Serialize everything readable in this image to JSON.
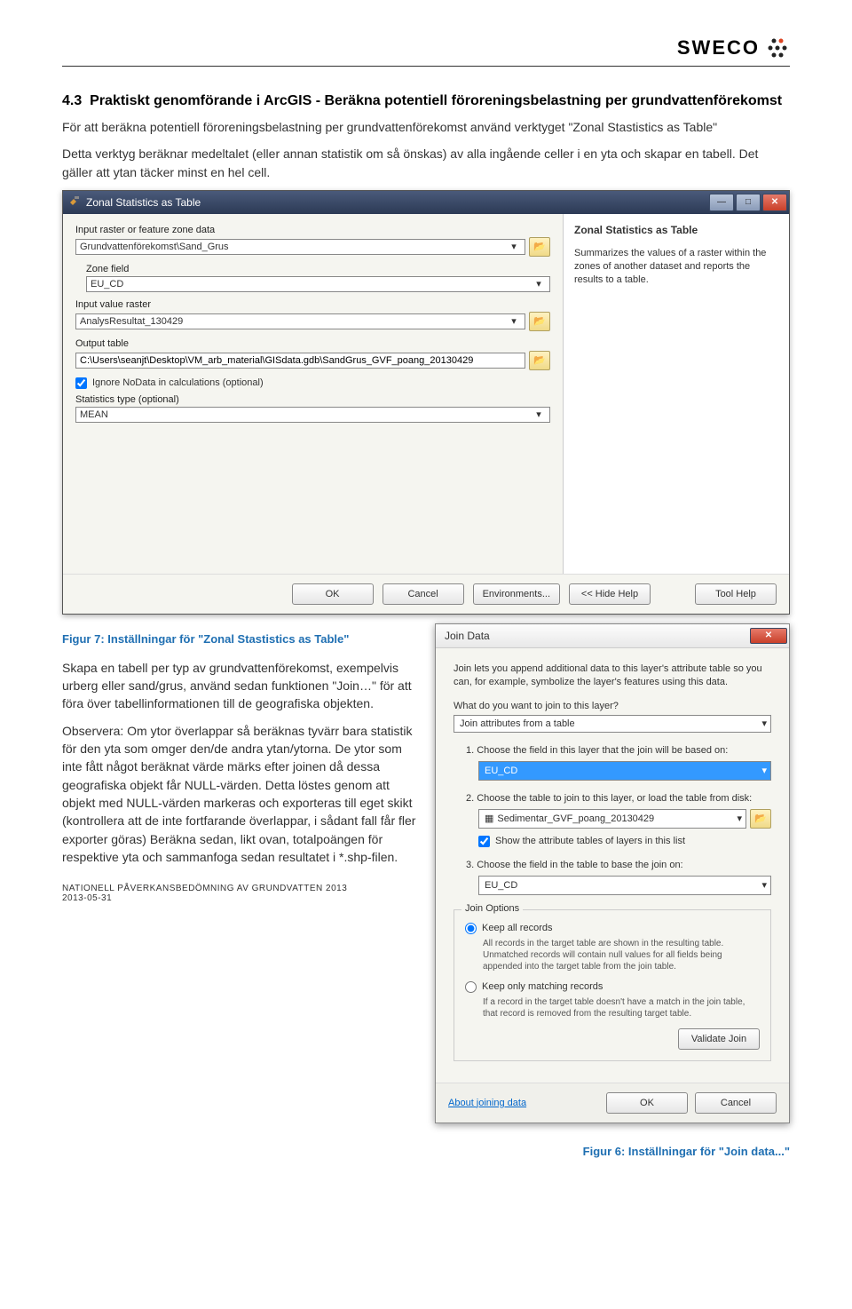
{
  "header": {
    "logo_text": "SWECO"
  },
  "section": {
    "number": "4.3",
    "title": "Praktiskt genomförande i ArcGIS - Beräkna potentiell föroreningsbelastning per grundvattenförekomst"
  },
  "para1": "För att beräkna potentiell föroreningsbelastning per grundvattenförekomst använd verktyget \"Zonal Stastistics as Table\"",
  "para2": "Detta verktyg beräknar medeltalet (eller annan statistik om så önskas) av alla ingående celler i en yta och skapar en tabell. Det gäller att ytan täcker minst en hel cell.",
  "zonal": {
    "title": "Zonal Statistics as Table",
    "help_title": "Zonal Statistics as Table",
    "help_text": "Summarizes the values of a raster within the zones of another dataset and reports the results to a table.",
    "labels": {
      "input_zone": "Input raster or feature zone data",
      "zone_field": "Zone field",
      "input_value": "Input value raster",
      "output_table": "Output table",
      "ignore": "Ignore NoData in calculations (optional)",
      "stat_type": "Statistics type (optional)"
    },
    "values": {
      "input_zone": "Grundvattenförekomst\\Sand_Grus",
      "zone_field": "EU_CD",
      "input_value": "AnalysResultat_130429",
      "output_table": "C:\\Users\\seanjt\\Desktop\\VM_arb_material\\GISdata.gdb\\SandGrus_GVF_poang_20130429",
      "stat_type": "MEAN"
    },
    "buttons": {
      "ok": "OK",
      "cancel": "Cancel",
      "env": "Environments...",
      "hide_help": "<< Hide Help",
      "tool_help": "Tool Help"
    }
  },
  "caption7": "Figur 7: Inställningar för \"Zonal Stastistics as Table\"",
  "para3": "Skapa en tabell per typ av grundvattenförekomst, exempelvis urberg eller sand/grus, använd sedan funktionen \"Join…\" för att föra över tabellinformationen till de geografiska objekten.",
  "para4": "Observera: Om ytor överlappar så beräknas tyvärr bara statistik för den yta som omger den/de andra ytan/ytorna. De ytor som inte fått något beräknat värde märks efter joinen då dessa geografiska objekt får NULL-värden. Detta löstes genom att objekt med NULL-värden markeras och exporteras till eget skikt (kontrollera att de inte fortfarande överlappar, i sådant fall får fler exporter göras) Beräkna sedan, likt ovan, totalpoängen för respektive yta och sammanfoga sedan resultatet i *.shp-filen.",
  "join": {
    "title": "Join Data",
    "intro": "Join lets you append additional data to this layer's attribute table so you can, for example, symbolize the layer's features using this data.",
    "question": "What do you want to join to this layer?",
    "what": "Join attributes from a table",
    "step1": "1.  Choose the field in this layer that the join will be based on:",
    "field1": "EU_CD",
    "step2": "2.  Choose the table to join to this layer, or load the table from disk:",
    "table2": "Sedimentar_GVF_poang_20130429",
    "show_attr": "Show the attribute tables of layers in this list",
    "step3": "3.  Choose the field in the table to base the join on:",
    "field3": "EU_CD",
    "opts_title": "Join Options",
    "keep_all": "Keep all records",
    "keep_all_desc": "All records in the target table are shown in the resulting table. Unmatched records will contain null values for all fields being appended into the target table from the join table.",
    "keep_match": "Keep only matching records",
    "keep_match_desc": "If a record in the target table doesn't have a match in the join table, that record is removed from the resulting target table.",
    "validate": "Validate Join",
    "about": "About joining data",
    "ok": "OK",
    "cancel": "Cancel"
  },
  "footer": {
    "line1": "NATIONELL PÅVERKANSBEDÖMNING AV GRUNDVATTEN 2013",
    "line2": "2013-05-31"
  },
  "caption6": "Figur 6: Inställningar för \"Join data...\""
}
